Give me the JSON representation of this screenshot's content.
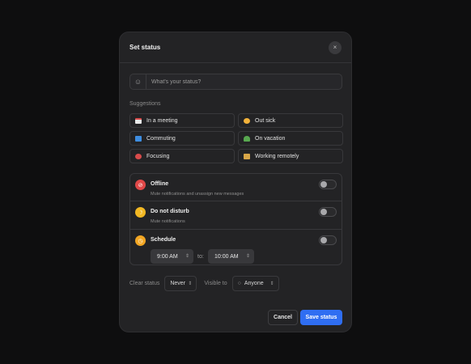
{
  "dialog": {
    "title": "Set status",
    "close_icon": "×"
  },
  "search": {
    "placeholder": "What's your status?",
    "emoji_icon": "☺"
  },
  "suggestions": {
    "label": "Suggestions",
    "items": [
      {
        "label": "In a meeting",
        "icon": "calendar-emoji",
        "color": "#e8e8e8"
      },
      {
        "label": "Out sick",
        "icon": "sick-face-emoji",
        "color": "#f2b23a"
      },
      {
        "label": "Commuting",
        "icon": "bus-emoji",
        "color": "#3e8de0"
      },
      {
        "label": "On vacation",
        "icon": "palm-tree-emoji",
        "color": "#58a850"
      },
      {
        "label": "Focusing",
        "icon": "target-emoji",
        "color": "#d84b4b"
      },
      {
        "label": "Working remotely",
        "icon": "house-emoji",
        "color": "#d8a648"
      }
    ]
  },
  "options": {
    "offline": {
      "name": "Offline",
      "desc": "Mute notifications and unassign new messages",
      "icon": "bell-off-icon",
      "color": "#e04848",
      "enabled": false
    },
    "dnd": {
      "name": "Do not disturb",
      "desc": "Mute notifications",
      "icon": "moon-icon",
      "color": "#f2b823",
      "enabled": false
    },
    "schedule": {
      "name": "Schedule",
      "icon": "clock-icon",
      "color": "#f2a623",
      "enabled": false,
      "from": "9:00 AM",
      "to_label": "to:",
      "to": "10:00 AM"
    }
  },
  "footer": {
    "clear_label": "Clear status",
    "clear_value": "Never",
    "visible_label": "Visible to",
    "visible_value": "Anyone"
  },
  "buttons": {
    "cancel": "Cancel",
    "save": "Save status"
  }
}
